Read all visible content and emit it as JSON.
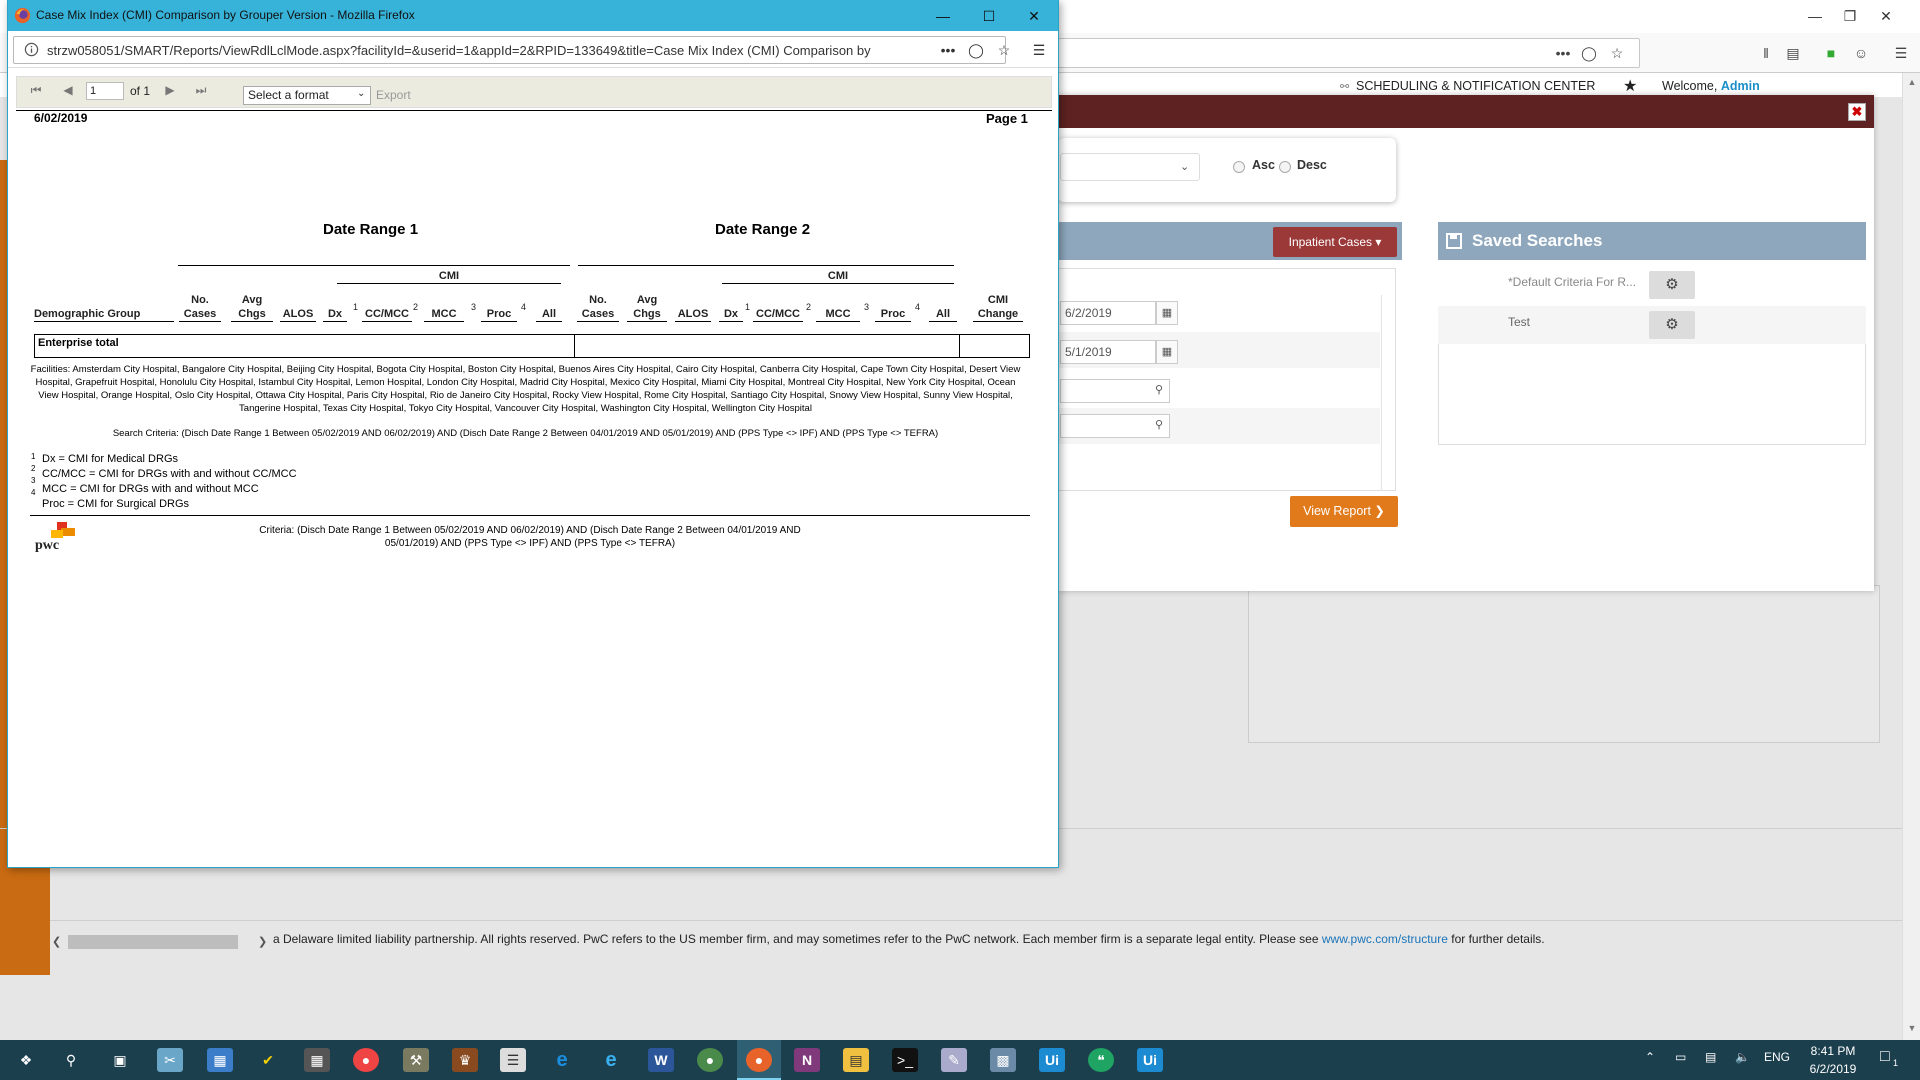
{
  "background_window": {
    "header": {
      "scheduling_label": "SCHEDULING & NOTIFICATION CENTER",
      "welcome_label": "Welcome,",
      "welcome_user": "Admin"
    },
    "sort": {
      "asc_label": "Asc",
      "desc_label": "Desc"
    },
    "criteria": {
      "dropdown_label": "Inpatient Cases",
      "date1": "6/2/2019",
      "date2": "5/1/2019",
      "view_report_label": "View Report"
    },
    "saved_searches": {
      "title": "Saved Searches",
      "items": [
        "*Default Criteria For R...",
        "Test"
      ]
    },
    "footer": {
      "text": "a Delaware limited liability partnership. All rights reserved. PwC refers to the US member firm, and may sometimes refer to the PwC network. Each member firm is a separate legal entity. Please see",
      "link": "www.pwc.com/structure",
      "text_after": "for further details."
    }
  },
  "popup": {
    "title": "Case Mix Index (CMI) Comparison by Grouper Version - Mozilla Firefox",
    "url": "strzw058051/SMART/Reports/ViewRdlLclMode.aspx?facilityId=&userid=1&appId=2&RPID=133649&title=Case Mix Index (CMI) Comparison by",
    "toolbar": {
      "page_value": "1",
      "page_of": "of 1",
      "format_placeholder": "Select a format",
      "export_label": "Export"
    },
    "report": {
      "date": "6/02/2019",
      "page_label": "Page 1",
      "date_range_1": "Date Range 1",
      "date_range_2": "Date Range 2",
      "cmi_group_label": "CMI",
      "columns": {
        "demographic_group": "Demographic Group",
        "no_cases_1": "No.",
        "no_cases_2": "Cases",
        "avg_chgs_1": "Avg",
        "avg_chgs_2": "Chgs",
        "alos": "ALOS",
        "dx": "Dx",
        "cc_mcc": "CC/MCC",
        "mcc": "MCC",
        "proc": "Proc",
        "all": "All",
        "cmi_change_1": "CMI",
        "cmi_change_2": "Change"
      },
      "superscripts": [
        "1",
        "2",
        "3",
        "4"
      ],
      "enterprise_total": "Enterprise total",
      "facilities": "Facilities: Amsterdam City Hospital, Bangalore City Hospital, Beijing City Hospital, Bogota City Hospital, Boston City Hospital, Buenos Aires City Hospital, Cairo City Hospital, Canberra City Hospital, Cape Town City Hospital, Desert View Hospital, Grapefruit Hospital, Honolulu City Hospital, Istambul City Hospital, Lemon Hospital, London City Hospital, Madrid City Hospital, Mexico City Hospital, Miami City Hospital, Montreal City Hospital, New York City Hospital, Ocean View Hospital, Orange Hospital, Oslo City Hospital, Ottawa City Hospital, Paris City Hospital, Rio de Janeiro City Hospital, Rocky View Hospital, Rome City Hospital, Santiago City Hospital, Snowy View Hospital, Sunny View Hospital, Tangerine Hospital, Texas City Hospital, Tokyo City Hospital, Vancouver City Hospital, Washington City Hospital, Wellington City Hospital",
      "search_criteria": "Search Criteria: (Disch Date Range 1 Between 05/02/2019 AND 06/02/2019) AND (Disch Date Range 2 Between 04/01/2019 AND 05/01/2019) AND (PPS Type <> IPF) AND (PPS Type <> TEFRA)",
      "legend": [
        {
          "num": "1",
          "text": "Dx = CMI for Medical DRGs"
        },
        {
          "num": "2",
          "text": "CC/MCC = CMI for DRGs with and without CC/MCC"
        },
        {
          "num": "3",
          "text": "MCC = CMI for DRGs with and without MCC"
        },
        {
          "num": "4",
          "text": "Proc = CMI for Surgical DRGs"
        }
      ],
      "logo_text": "pwc",
      "footer_criteria": "Criteria: (Disch Date Range 1 Between 05/02/2019 AND 06/02/2019) AND (Disch Date Range 2 Between 04/01/2019 AND 05/01/2019) AND (PPS Type <> IPF) AND (PPS Type <> TEFRA)"
    }
  },
  "taskbar": {
    "language": "ENG",
    "time": "8:41 PM",
    "date": "6/2/2019",
    "notification_count": "1",
    "icons": [
      "start-icon",
      "search-icon",
      "task-view-icon",
      "snipping-icon",
      "store-icon",
      "norton-icon",
      "calculator-icon",
      "chrome-icon",
      "tools-icon",
      "game-icon",
      "notepad-icon",
      "edge-icon",
      "ie-icon",
      "word-icon",
      "chrome-profile-icon",
      "firefox-icon",
      "onenote-icon",
      "explorer-icon",
      "cmd-icon",
      "notes-icon",
      "app-icon",
      "uipath-studio-icon",
      "hangouts-icon",
      "uipath-robot-icon"
    ]
  },
  "colors": {
    "popup_titlebar": "#37b3da",
    "modal_header": "#5e2222",
    "accent_orange": "#e07a1a",
    "panel_blue": "#8ea7bd",
    "taskbar": "#1c3f4e"
  }
}
